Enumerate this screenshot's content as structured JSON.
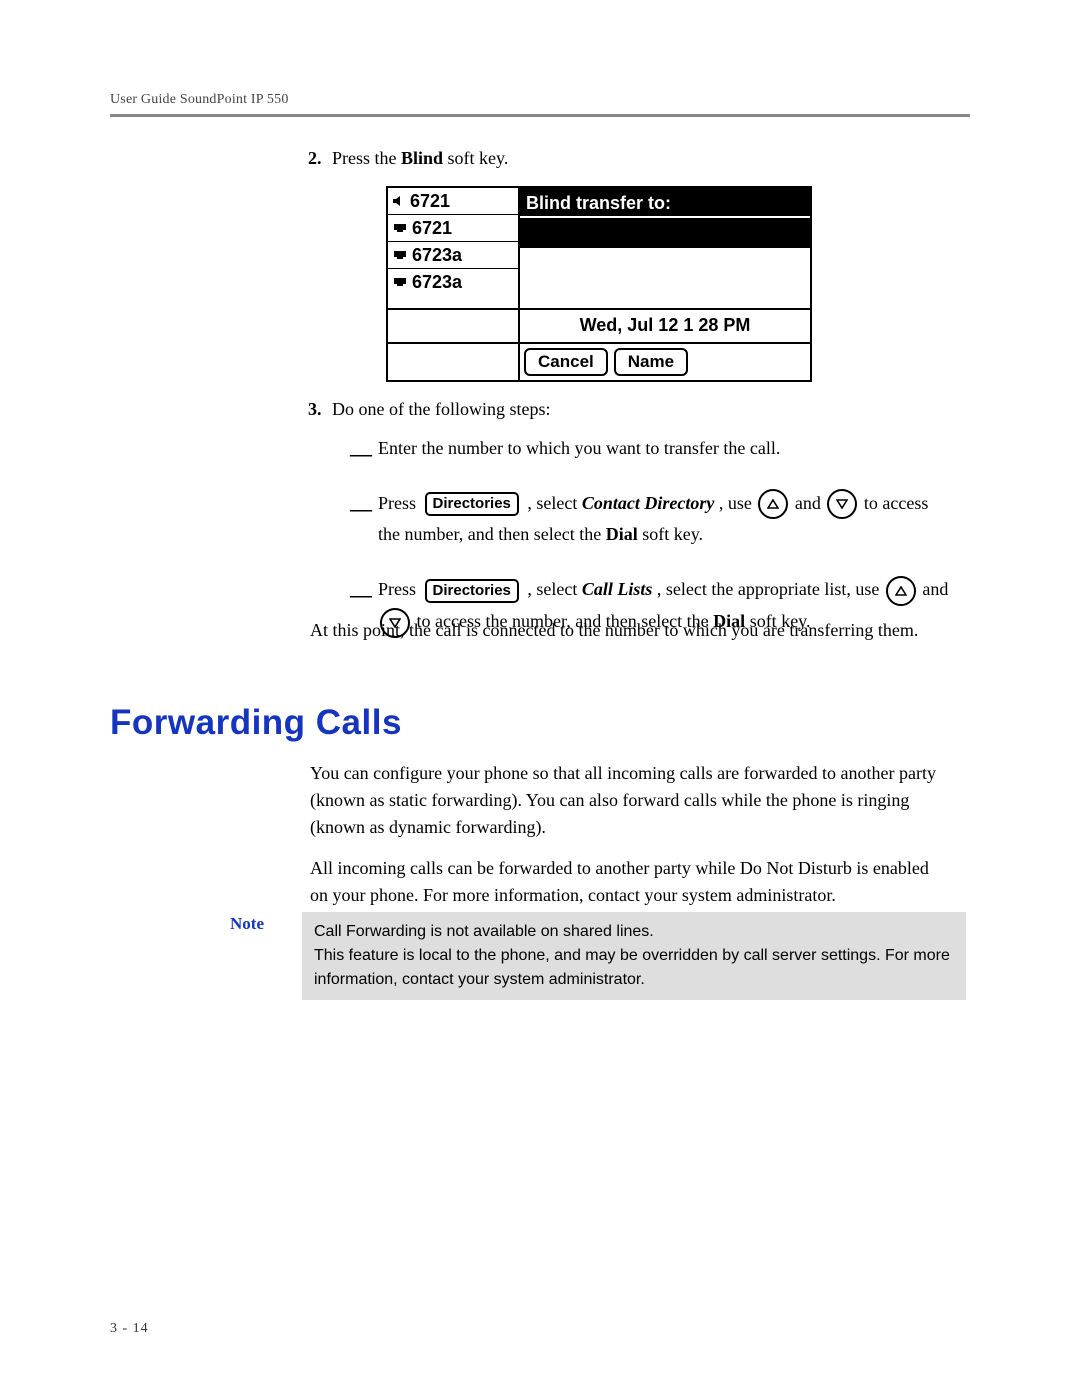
{
  "header": "User Guide SoundPoint IP 550",
  "step2": {
    "num": "2.",
    "pre": "Press the ",
    "bold": "Blind",
    "post": " soft key."
  },
  "phone": {
    "lines": [
      "6721",
      "6721",
      "6723a",
      "6723a"
    ],
    "title": "Blind transfer to:",
    "date": "Wed, Jul 12  1 28 PM",
    "sk1": "Cancel",
    "sk2": "Name"
  },
  "step3": {
    "num": "3.",
    "text": "Do one of the following steps:",
    "a": "Enter the number to which you want to transfer the call.",
    "b": {
      "press": "Press ",
      "dir": "Directories",
      "mid1": " , select ",
      "cd": "Contact Directory",
      "mid2": ", use ",
      "and": " and ",
      "tail": " to access the number, and then select the ",
      "dial": "Dial",
      "end": " soft key."
    },
    "c": {
      "press": "Press  ",
      "dir": "Directories",
      "mid1": " , select ",
      "cl": "Call Lists",
      "mid2": ", select the appropriate list, use ",
      "and": " and ",
      "tail": " to access the number, and then select the ",
      "dial": "Dial",
      "end": " soft key."
    }
  },
  "after": "At this point, the call is connected to the number to which you are transferring them.",
  "h2": "Forwarding Calls",
  "fwd": {
    "p1": "You can configure your phone so that all incoming calls are forwarded to another party (known as static forwarding). You can also forward calls while the phone is ringing (known as dynamic forwarding).",
    "p2": "All incoming calls can be forwarded to another party while Do Not Disturb is enabled on your phone. For more information, contact your system administrator."
  },
  "note": {
    "label": "Note",
    "l1": "Call Forwarding is not available on shared lines.",
    "l2": "This feature is local to the phone, and may be overridden by call server settings. For more information, contact your system administrator."
  },
  "pagenum": "3 - 14"
}
